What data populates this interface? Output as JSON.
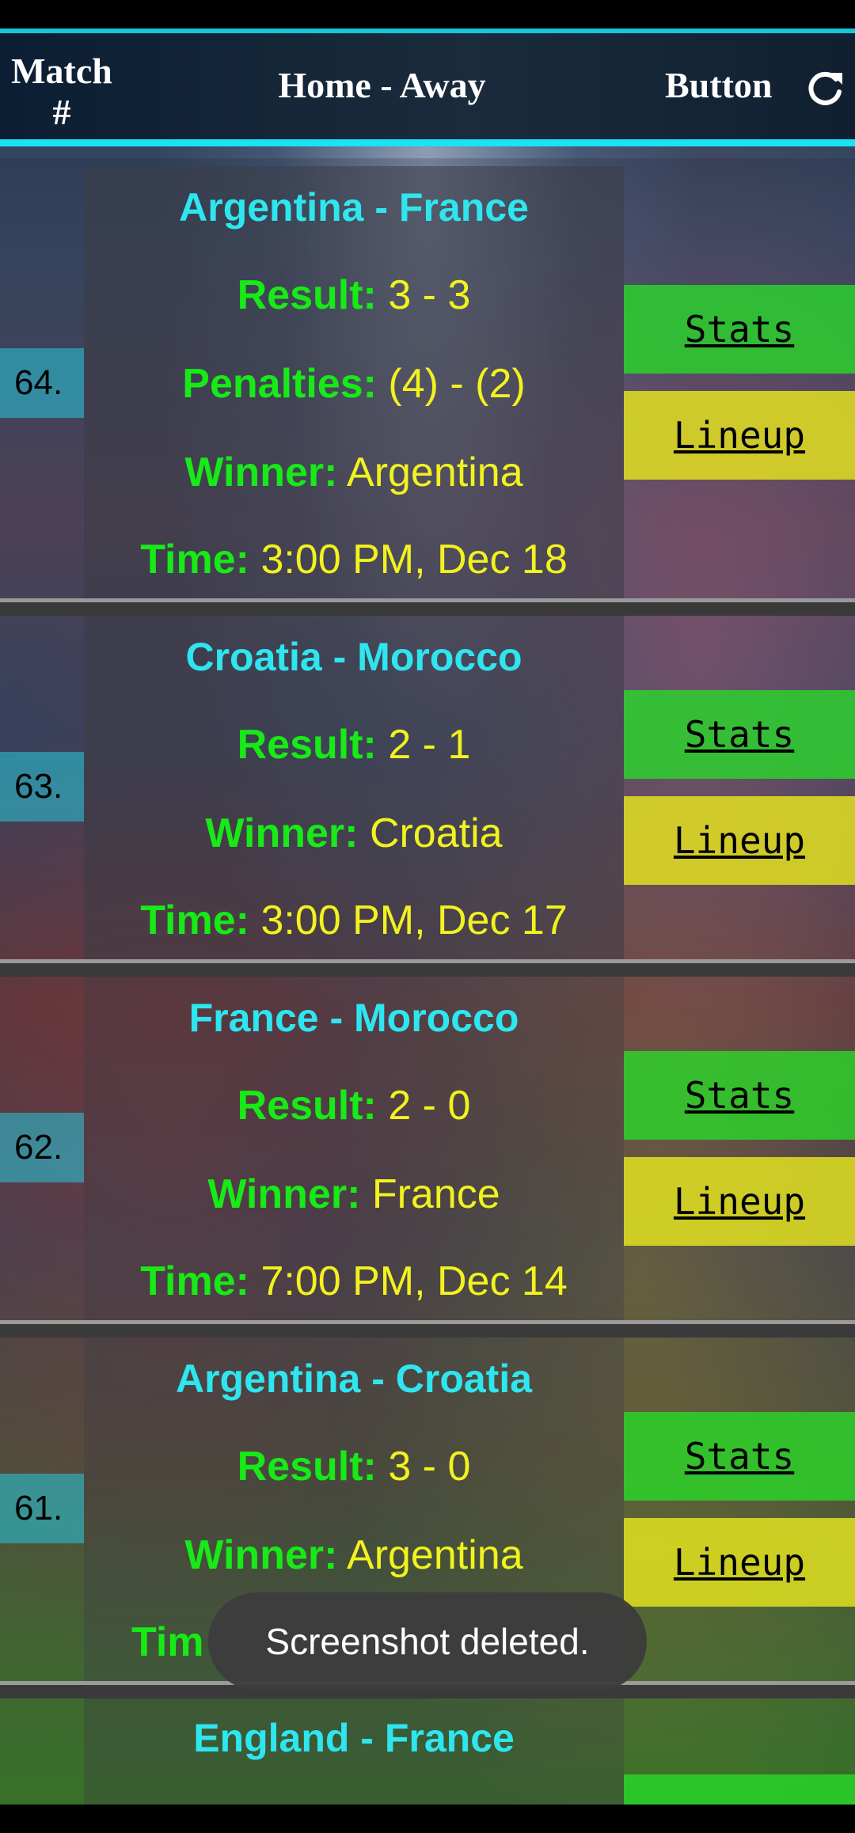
{
  "header": {
    "match_label": "Match\n#",
    "home_away_label": "Home - Away",
    "button_label": "Button"
  },
  "matches": [
    {
      "number": "64.",
      "teams": "Argentina - France",
      "result_label": "Result:",
      "result_value": "3 - 3",
      "penalties_label": "Penalties:",
      "penalties_value": "(4) - (2)",
      "winner_label": "Winner:",
      "winner_value": "Argentina",
      "time_label": "Time:",
      "time_value": "3:00 PM, Dec 18",
      "stats_label": "Stats",
      "lineup_label": "Lineup"
    },
    {
      "number": "63.",
      "teams": "Croatia - Morocco",
      "result_label": "Result:",
      "result_value": "2 - 1",
      "winner_label": "Winner:",
      "winner_value": "Croatia",
      "time_label": "Time:",
      "time_value": "3:00 PM, Dec 17",
      "stats_label": "Stats",
      "lineup_label": "Lineup"
    },
    {
      "number": "62.",
      "teams": "France - Morocco",
      "result_label": "Result:",
      "result_value": "2 - 0",
      "winner_label": "Winner:",
      "winner_value": "France",
      "time_label": "Time:",
      "time_value": "7:00 PM, Dec 14",
      "stats_label": "Stats",
      "lineup_label": "Lineup"
    },
    {
      "number": "61.",
      "teams": "Argentina - Croatia",
      "result_label": "Result:",
      "result_value": "3 - 0",
      "winner_label": "Winner:",
      "winner_value": "Argentina",
      "time_label": "Tim",
      "stats_label": "Stats",
      "lineup_label": "Lineup"
    },
    {
      "teams": "England - France"
    }
  ],
  "toast": "Screenshot deleted.",
  "icons": {
    "refresh": "refresh-icon"
  },
  "colors": {
    "accent": "#19e4f2",
    "team_text": "#2ee6ef",
    "label_green": "#17ea17",
    "value_yellow": "#f2f21e",
    "stats_bg": "#28dc28",
    "lineup_bg": "#e6e61e"
  }
}
